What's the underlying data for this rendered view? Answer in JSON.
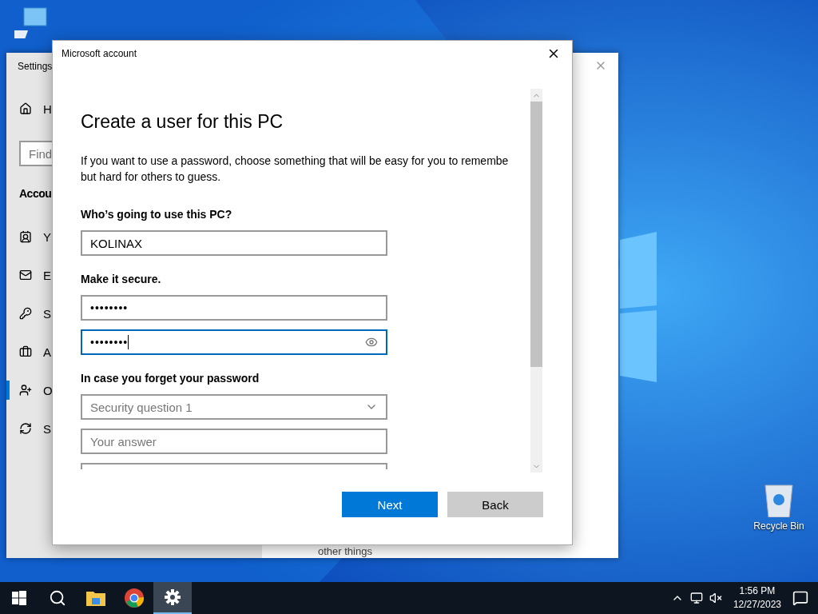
{
  "settings_window": {
    "title": "Settings",
    "home_item": "H",
    "search": {
      "placeholder": "Find"
    },
    "section": "Accou",
    "items": [
      {
        "label": "Y",
        "selected": false
      },
      {
        "label": "E",
        "selected": false
      },
      {
        "label": "S",
        "selected": false
      },
      {
        "label": "A",
        "selected": false
      },
      {
        "label": "O",
        "selected": true
      },
      {
        "label": "S",
        "selected": false
      }
    ],
    "content_text": "other things"
  },
  "dialog": {
    "title": "Microsoft account",
    "heading": "Create a user for this PC",
    "description_lines": [
      "If you want to use a password, choose something that will be easy for you to remembe",
      "but hard for others to guess."
    ],
    "sections": [
      {
        "label": "Who’s going to use this PC?",
        "fields": [
          {
            "kind": "text",
            "value": "KOLINAX",
            "focused": false
          }
        ]
      },
      {
        "label": "Make it secure.",
        "fields": [
          {
            "kind": "password",
            "value": "••••••••",
            "focused": false
          },
          {
            "kind": "password",
            "value": "••••••••",
            "focused": true
          }
        ]
      },
      {
        "label": "In case you forget your password",
        "fields": [
          {
            "kind": "dropdown",
            "placeholder": "Security question 1",
            "focused": false
          },
          {
            "kind": "text",
            "placeholder": "Your answer",
            "focused": false
          },
          {
            "kind": "partial"
          }
        ]
      }
    ],
    "buttons": [
      {
        "label": "Next",
        "primary": true
      },
      {
        "label": "Back",
        "primary": false
      }
    ]
  },
  "desktop_icons": [
    {
      "label": "Recycle Bin"
    }
  ],
  "taskbar": {
    "apps": [
      {
        "selected": false
      },
      {
        "selected": false
      },
      {
        "selected": false
      },
      {
        "selected": true
      }
    ],
    "time": "1:56 PM",
    "date": "12/27/2023"
  }
}
